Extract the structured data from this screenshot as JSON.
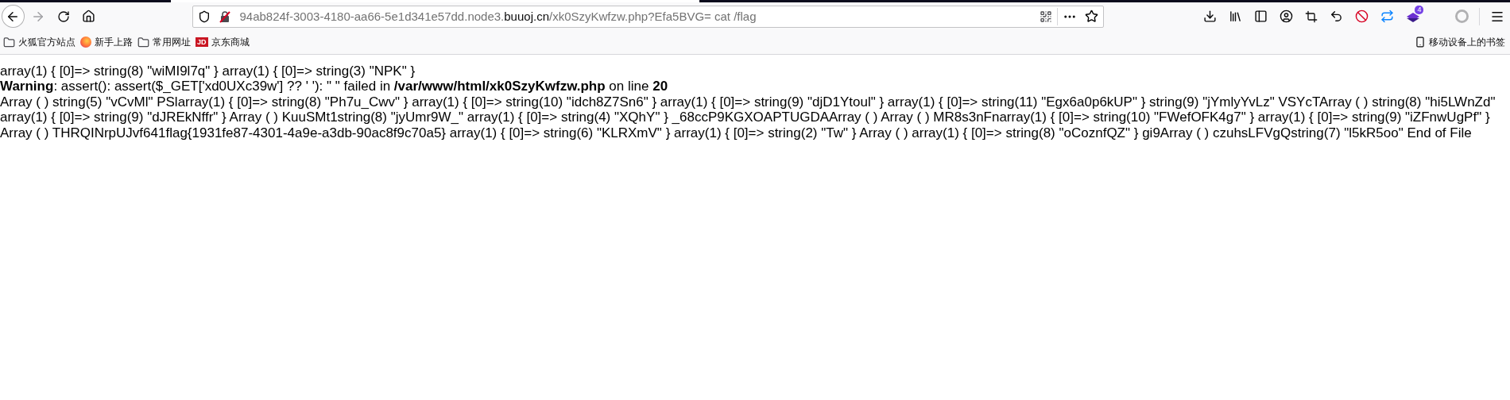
{
  "toolbar": {
    "url": {
      "prefix": "94ab824f-3003-4180-aa66-5e1d341e57dd.node3.",
      "domain": "buuoj.cn",
      "suffix": "/xk0SzyKwfzw.php?Efa5BVG= cat /flag"
    },
    "forward_disabled": true,
    "extension_badge": "4"
  },
  "bookmarks": [
    {
      "kind": "folder",
      "label": "火狐官方站点"
    },
    {
      "kind": "firefox",
      "label": "新手上路"
    },
    {
      "kind": "folder",
      "label": "常用网址"
    },
    {
      "kind": "jd",
      "logo": "JD",
      "label": "京东商城"
    }
  ],
  "mobile_bookmarks": "移动设备上的书签",
  "page_lines": [
    "array(1) { [0]=> string(8) \"wiMI9l7q\" } array(1) { [0]=> string(3) \"NPK\" }",
    "**Warning**: assert(): assert($_GET['xd0UXc39w'] ?? ' '): \" \" failed in **/var/www/html/xk0SzyKwfzw.php** on line **20**",
    "Array ( ) string(5) \"vCvMl\" PSlarray(1) { [0]=> string(8) \"Ph7u_Cwv\" } array(1) { [0]=> string(10) \"idch8Z7Sn6\" } array(1) { [0]=> string(9) \"djD1Ytoul\" } array(1) { [0]=> string(11) \"Egx6a0p6kUP\" } string(9) \"jYmlyYvLz\" VSYcTArray ( ) string(8) \"hi5LWnZd\"",
    "array(1) { [0]=> string(9) \"dJREkNffr\" } Array ( ) KuuSMt1string(8) \"jyUmr9W_\" array(1) { [0]=> string(4) \"XQhY\" } _68ccP9KGXOAPTUGDAArray ( ) Array ( ) MR8s3nFnarray(1) { [0]=> string(10) \"FWefOFK4g7\" } array(1) { [0]=> string(9) \"iZFnwUgPf\" }",
    "Array ( ) THRQINrpUJvf641flag{1931fe87-4301-4a9e-a3db-90ac8f9c70a5} array(1) { [0]=> string(6) \"KLRXmV\" } array(1) { [0]=> string(2) \"Tw\" } Array ( ) array(1) { [0]=> string(8) \"oCoznfQZ\" } gi9Array ( ) czuhsLFVgQstring(7) \"l5kR5oo\" End of File"
  ]
}
